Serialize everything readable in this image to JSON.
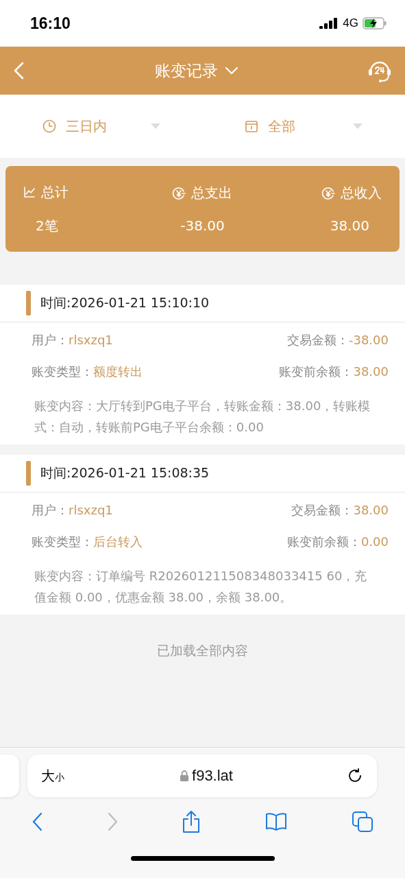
{
  "status_bar": {
    "time": "16:10",
    "network": "4G"
  },
  "header": {
    "title": "账变记录"
  },
  "filters": [
    {
      "label": "三日内",
      "kind": "time"
    },
    {
      "label": "全部",
      "kind": "category"
    }
  ],
  "summary": [
    {
      "label": "总计",
      "value": "2笔",
      "kind": "count"
    },
    {
      "label": "总支出",
      "value": "-38.00",
      "kind": "money"
    },
    {
      "label": "总收入",
      "value": "38.00",
      "kind": "money"
    }
  ],
  "records": [
    {
      "time": "时间:2026-01-21 15:10:10",
      "user_label": "用户：",
      "user": "rlsxzq1",
      "amount_label": "交易金额：",
      "amount": "-38.00",
      "type_label": "账变类型：",
      "type": "额度转出",
      "balance_label": "账变前余额：",
      "balance": "38.00",
      "content": "账变内容：大厅转到PG电子平台，转账金额：38.00，转账模式：自动，转账前PG电子平台余额：0.00"
    },
    {
      "time": "时间:2026-01-21 15:08:35",
      "user_label": "用户：",
      "user": "rlsxzq1",
      "amount_label": "交易金额：",
      "amount": "38.00",
      "type_label": "账变类型：",
      "type": "后台转入",
      "balance_label": "账变前余额：",
      "balance": "0.00",
      "content": "账变内容：订单编号 R202601211508348033415 60，充值金额 0.00，优惠金额 38.00，余额 38.00。"
    }
  ],
  "footer_note": "已加载全部内容",
  "browser": {
    "text_size_large": "大",
    "text_size_small": "小",
    "url": "f93.lat"
  }
}
